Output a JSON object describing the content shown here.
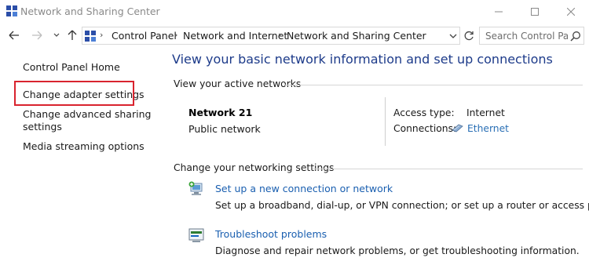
{
  "window": {
    "title": "Network and Sharing Center"
  },
  "address_bar": {
    "crumbs": [
      "Control Panel",
      "Network and Internet",
      "Network and Sharing Center"
    ],
    "search_placeholder": "Search Control Pa..."
  },
  "left_pane": {
    "links": [
      "Control Panel Home",
      "Change adapter settings",
      "Change advanced sharing",
      "settings",
      "Media streaming options"
    ]
  },
  "main": {
    "heading": "View your basic network information and set up connections",
    "active_networks": {
      "label": "View your active networks",
      "network_name": "Network  21",
      "network_category": "Public network",
      "access_type_label": "Access type:",
      "access_type_value": "Internet",
      "connections_label": "Connections:",
      "connections_value": "Ethernet"
    },
    "networking_settings": {
      "label": "Change your networking settings",
      "tasks": [
        {
          "title": "Set up a new connection or network",
          "description": "Set up a broadband, dial-up, or VPN connection; or set up a router or access point."
        },
        {
          "title": "Troubleshoot problems",
          "description": "Diagnose and repair network problems, or get troubleshooting information."
        }
      ]
    }
  },
  "colors": {
    "heading": "#1d3b8a",
    "link": "#1a5fb0",
    "highlight": "#d9232e"
  }
}
